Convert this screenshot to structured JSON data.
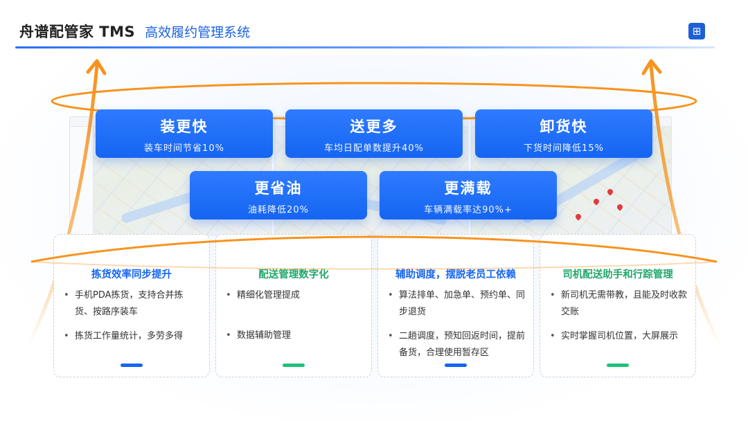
{
  "header": {
    "title": "舟谱配管家 TMS",
    "subtitle": "高效履约管理系统"
  },
  "logo_icon": "box-logo-icon",
  "colors": {
    "brand_blue": "#1565f2",
    "accent_orange": "#f7931e",
    "accent_green": "#20c07a"
  },
  "features": [
    {
      "title": "装更快",
      "desc": "装车时间节省10%"
    },
    {
      "title": "送更多",
      "desc": "车均日配单数提升40%"
    },
    {
      "title": "卸货快",
      "desc": "下货时间降低15%"
    },
    {
      "title": "更省油",
      "desc": "油耗降低20%"
    },
    {
      "title": "更满载",
      "desc": "车辆满载率达90%+"
    }
  ],
  "panels": [
    {
      "title": "拣货效率同步提升",
      "color": "#1565f2",
      "items": [
        "手机PDA拣货，支持合并拣货、按路序装车",
        "拣货工作量统计，多劳多得"
      ]
    },
    {
      "title": "配送管理数字化",
      "color": "#20c07a",
      "items": [
        "精细化管理提成",
        "数据辅助管理"
      ]
    },
    {
      "title": "辅助调度，摆脱老员工依赖",
      "color": "#1565f2",
      "items": [
        "算法排单、加急单、预约单、同步退货",
        "二趟调度，预知回返时间，提前备货，合理使用暂存区"
      ]
    },
    {
      "title": "司机配送助手和行踪管理",
      "color": "#20c07a",
      "items": [
        "新司机无需带教，且能及时收款交账",
        "实时掌握司机位置，大屏展示"
      ]
    }
  ]
}
